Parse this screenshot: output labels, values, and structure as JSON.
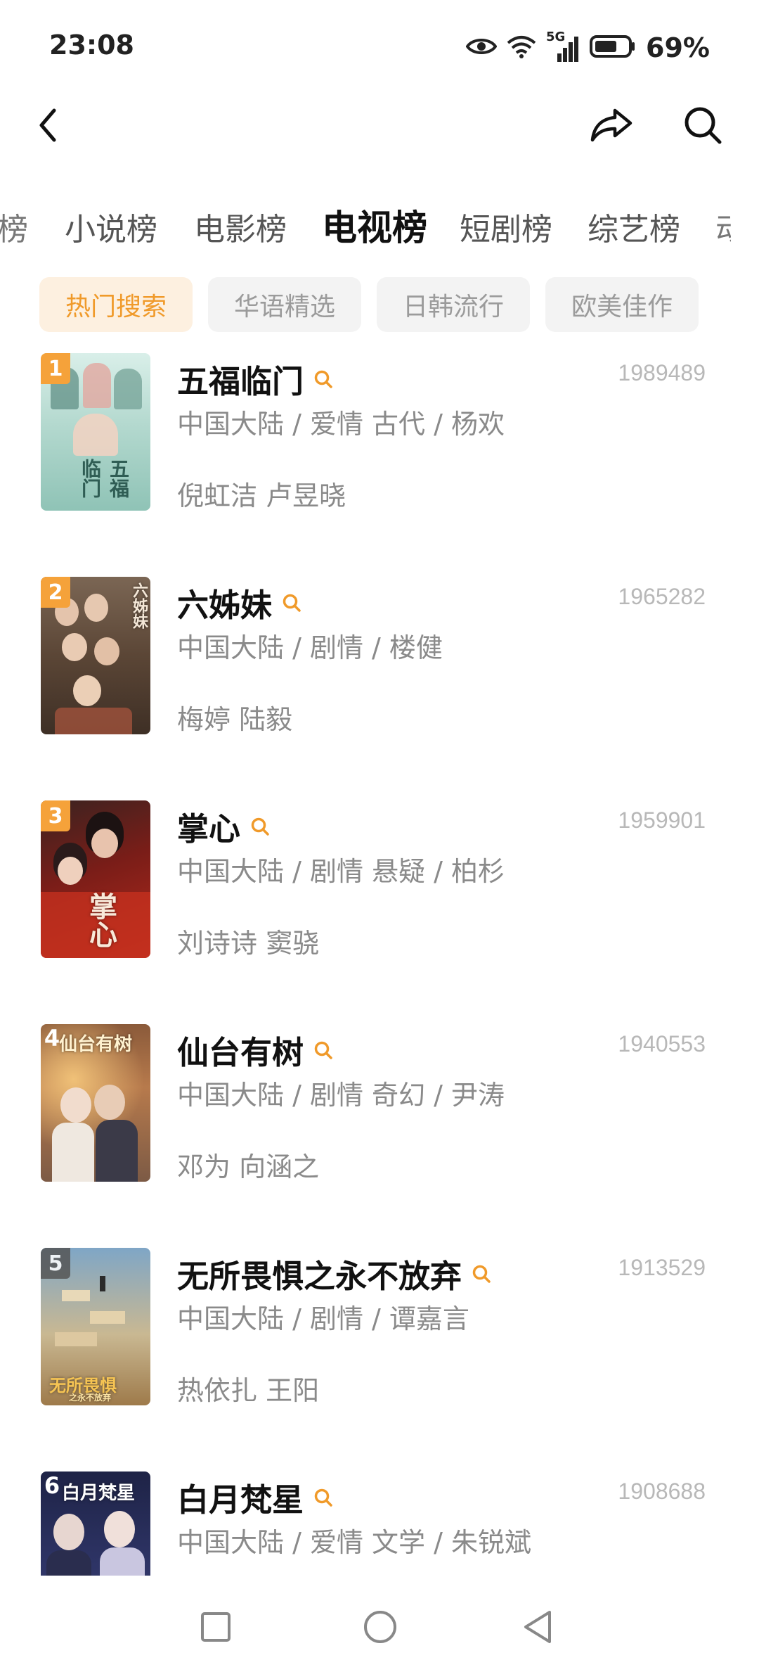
{
  "status_bar": {
    "time": "23:08",
    "network": "5G",
    "battery_percent": "69%",
    "icons": [
      "eye-icon",
      "wifi-icon",
      "cellular-signal-icon",
      "battery-icon"
    ]
  },
  "top_nav": {
    "icons": [
      "back-arrow-icon",
      "share-icon",
      "search-icon"
    ]
  },
  "category_tabs": {
    "left_partial": "榜",
    "items": [
      "小说榜",
      "电影榜",
      "电视榜",
      "短剧榜",
      "综艺榜"
    ],
    "active": "电视榜",
    "right_partial": "动"
  },
  "filter_chips": {
    "items": [
      "热门搜索",
      "华语精选",
      "日韩流行",
      "欧美佳作"
    ],
    "active": "热门搜索"
  },
  "list": [
    {
      "rank": "1",
      "title": "五福临门",
      "score": "1989489",
      "meta": "中国大陆 / 爱情 古代 / 杨欢",
      "cast": "倪虹洁 卢昱晓",
      "poster_text": "五福临门"
    },
    {
      "rank": "2",
      "title": "六姊妹",
      "score": "1965282",
      "meta": "中国大陆 / 剧情 / 楼健",
      "cast": "梅婷 陆毅",
      "poster_text": "六姊妹"
    },
    {
      "rank": "3",
      "title": "掌心",
      "score": "1959901",
      "meta": "中国大陆 / 剧情 悬疑 / 柏杉",
      "cast": "刘诗诗 窦骁",
      "poster_text": "掌心"
    },
    {
      "rank": "4",
      "title": "仙台有树",
      "score": "1940553",
      "meta": "中国大陆 / 剧情 奇幻 / 尹涛",
      "cast": "邓为 向涵之",
      "poster_text": "仙台有树"
    },
    {
      "rank": "5",
      "title": "无所畏惧之永不放弃",
      "score": "1913529",
      "meta": "中国大陆 / 剧情 / 谭嘉言",
      "cast": "热依扎 王阳",
      "poster_text": "无所畏惧",
      "poster_subtext": "之永不放弃"
    },
    {
      "rank": "6",
      "title": "白月梵星",
      "score": "1908688",
      "meta": "中国大陆 / 爱情 文学 / 朱锐斌",
      "cast": "",
      "poster_text": "白月梵星"
    }
  ],
  "colors": {
    "accent": "#f09a2a",
    "chip_active_bg": "#fdf0e0",
    "score_gray": "#b8b8b8",
    "meta_gray": "#8a8a8a"
  },
  "system_nav": {
    "icons": [
      "recents-square-icon",
      "home-circle-icon",
      "back-triangle-icon"
    ]
  }
}
